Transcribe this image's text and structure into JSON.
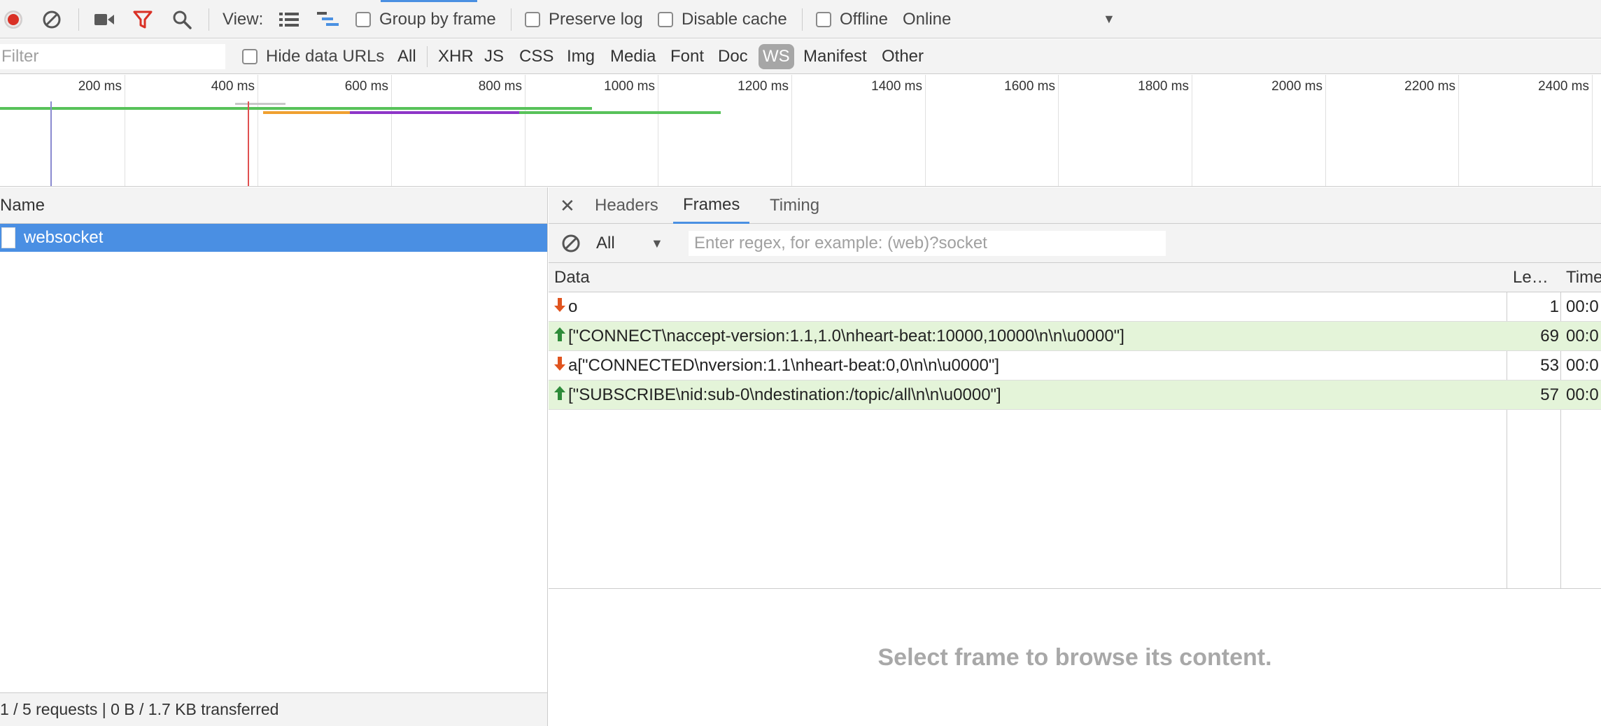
{
  "toolbar": {
    "view_label": "View:",
    "group_by_frame": "Group by frame",
    "preserve_log": "Preserve log",
    "disable_cache": "Disable cache",
    "offline": "Offline",
    "throttling_value": "Online"
  },
  "filterbar": {
    "filter_placeholder": "Filter",
    "hide_data_urls": "Hide data URLs",
    "types": [
      "All",
      "XHR",
      "JS",
      "CSS",
      "Img",
      "Media",
      "Font",
      "Doc",
      "WS",
      "Manifest",
      "Other"
    ],
    "active_type": "WS"
  },
  "overview": {
    "ticks": [
      "200 ms",
      "400 ms",
      "600 ms",
      "800 ms",
      "1000 ms",
      "1200 ms",
      "1400 ms",
      "1600 ms",
      "1800 ms",
      "2000 ms",
      "2200 ms",
      "2400 ms"
    ]
  },
  "requests": {
    "name_header": "Name",
    "items": [
      {
        "name": "websocket"
      }
    ],
    "status": "1 / 5 requests | 0 B / 1.7 KB transferred"
  },
  "detail": {
    "tabs": [
      "Headers",
      "Frames",
      "Timing"
    ],
    "active_tab": "Frames",
    "frames_filter_value": "All",
    "regex_placeholder": "Enter regex, for example: (web)?socket",
    "columns": {
      "data": "Data",
      "length": "Le…",
      "time": "Time"
    },
    "frames": [
      {
        "direction": "received",
        "data": "o",
        "length": "1",
        "time": "00:0"
      },
      {
        "direction": "sent",
        "data": "[\"CONNECT\\naccept-version:1.1,1.0\\nheart-beat:10000,10000\\n\\n\\u0000\"]",
        "length": "69",
        "time": "00:0"
      },
      {
        "direction": "received",
        "data": "a[\"CONNECTED\\nversion:1.1\\nheart-beat:0,0\\n\\n\\u0000\"]",
        "length": "53",
        "time": "00:0"
      },
      {
        "direction": "sent",
        "data": "[\"SUBSCRIBE\\nid:sub-0\\ndestination:/topic/all\\n\\n\\u0000\"]",
        "length": "57",
        "time": "00:0"
      }
    ],
    "empty_message": "Select frame to browse its content."
  },
  "colors": {
    "record": "#d93025",
    "selected_row": "#4a8fe3",
    "sent_row": "#e4f4d9",
    "sent_arrow": "#2e8b3a",
    "received_arrow": "#e0541f",
    "active_tab": "#4a90e2"
  }
}
